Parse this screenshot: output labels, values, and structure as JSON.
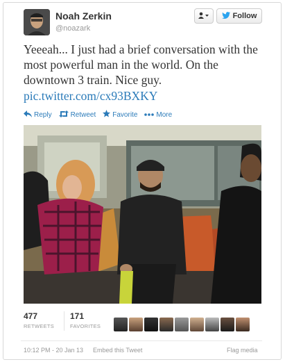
{
  "user": {
    "name": "Noah Zerkin",
    "handle": "@noazark"
  },
  "header": {
    "user_menu_icon": "person-dropdown-icon",
    "follow_label": "Follow",
    "follow_icon": "twitter-bird-icon"
  },
  "tweet": {
    "text": "Yeeeah... I just had a brief conversation with the most powerful man in the world. On the downtown 3 train. Nice guy.",
    "link": "pic.twitter.com/cx93BXKY"
  },
  "actions": [
    {
      "label": "Reply",
      "icon": "reply-arrow-icon"
    },
    {
      "label": "Retweet",
      "icon": "retweet-icon"
    },
    {
      "label": "Favorite",
      "icon": "star-icon"
    },
    {
      "label": "More",
      "icon": "more-dots-icon"
    }
  ],
  "stats": {
    "retweets_count": "477",
    "retweets_label": "RETWEETS",
    "favorites_count": "171",
    "favorites_label": "FAVORITES"
  },
  "footer": {
    "timestamp": "10:12 PM - 20 Jan 13",
    "embed": "Embed this Tweet",
    "flag": "Flag media"
  },
  "colors": {
    "link": "#2b7bb9",
    "bird": "#2aa3ef"
  }
}
